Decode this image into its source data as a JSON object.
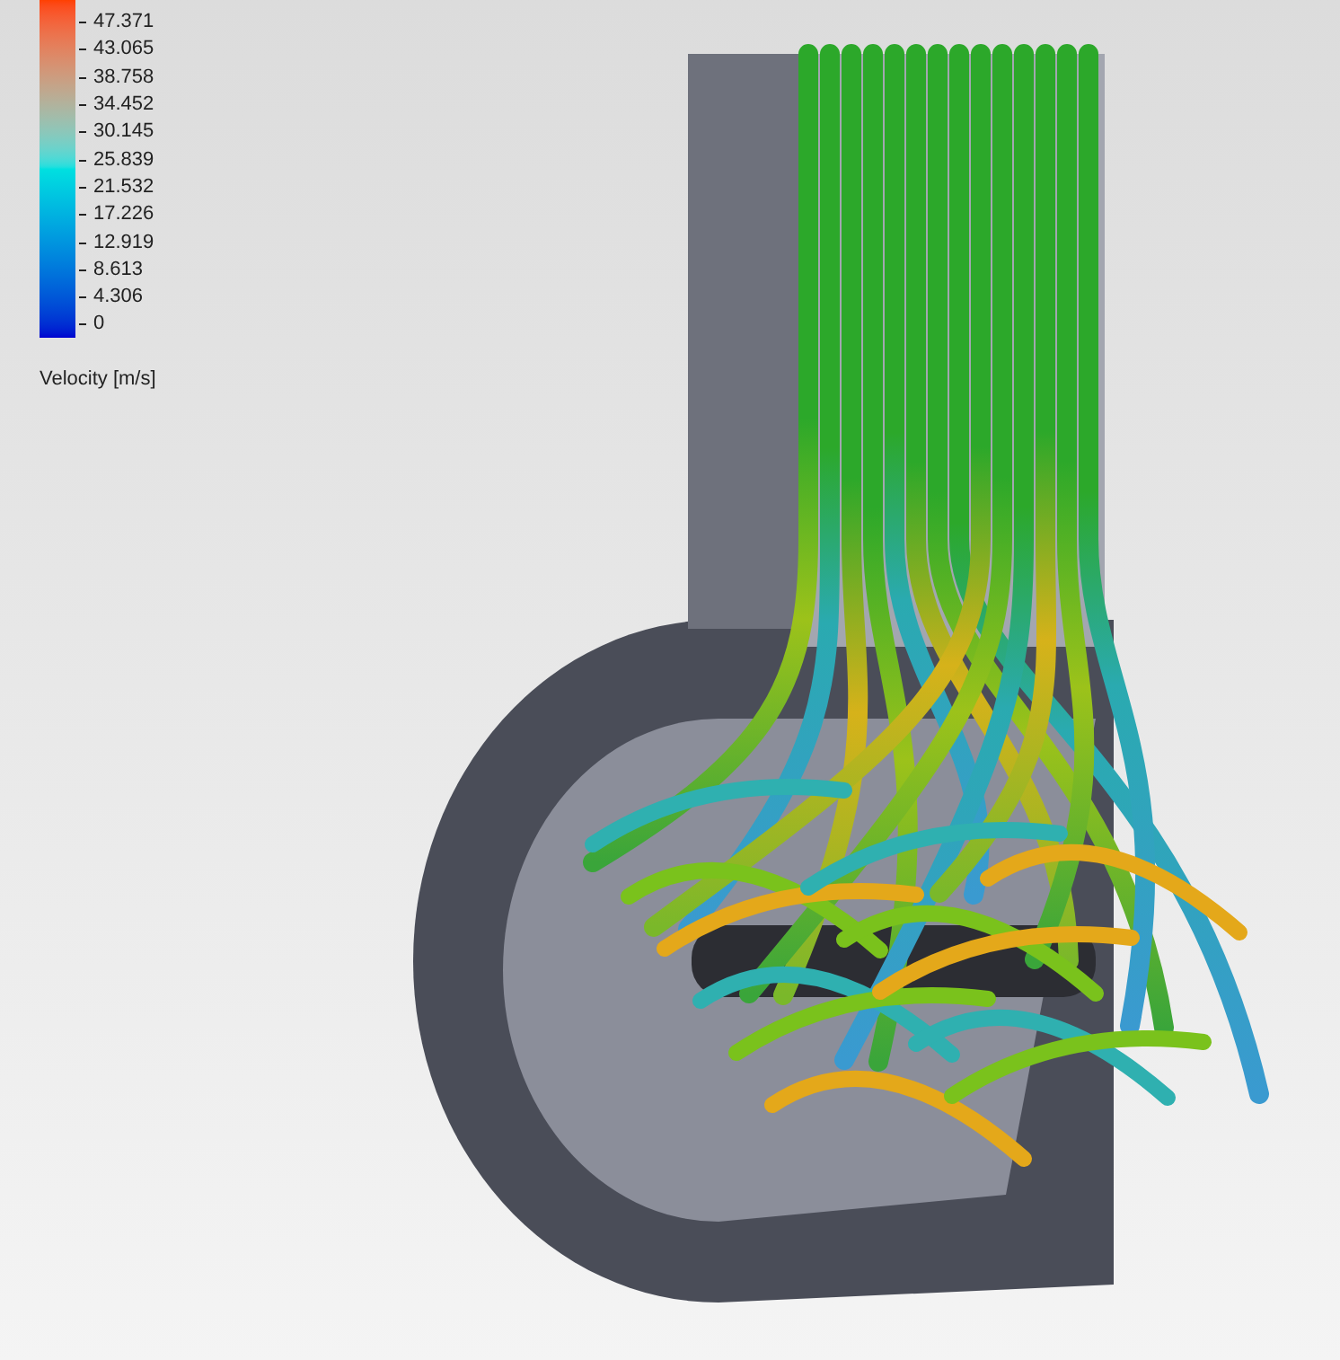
{
  "legend": {
    "ticks": [
      "47.371",
      "43.065",
      "38.758",
      "34.452",
      "30.145",
      "25.839",
      "21.532",
      "17.226",
      "12.919",
      "8.613",
      "4.306",
      "0"
    ],
    "title": "Velocity [m/s]"
  }
}
